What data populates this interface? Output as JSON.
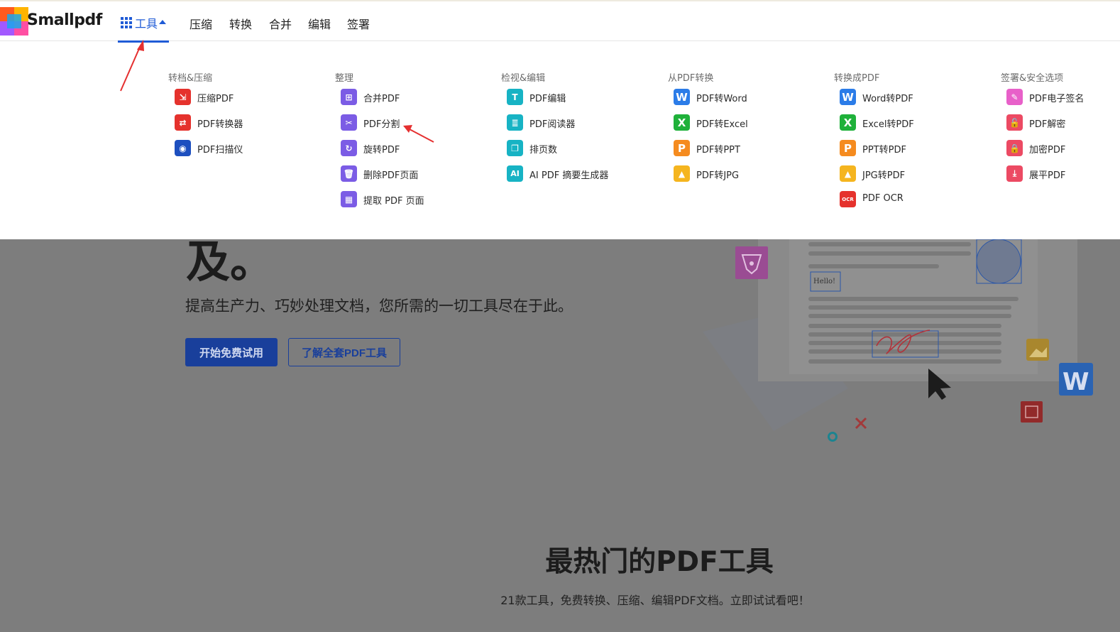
{
  "header": {
    "brand": "Smallpdf",
    "nav": {
      "tools": "工具",
      "items": [
        "压缩",
        "转换",
        "合并",
        "编辑",
        "签署"
      ]
    }
  },
  "menu": {
    "columns": [
      {
        "title": "转档&压缩",
        "items": [
          {
            "label": "压缩PDF",
            "icon": "compress-icon",
            "color": "#e5322d"
          },
          {
            "label": "PDF转换器",
            "icon": "convert-icon",
            "color": "#e5322d"
          },
          {
            "label": "PDF扫描仪",
            "icon": "camera-icon",
            "color": "#1d4fbf"
          }
        ]
      },
      {
        "title": "整理",
        "items": [
          {
            "label": "合并PDF",
            "icon": "merge-icon",
            "color": "#7b5ce5"
          },
          {
            "label": "PDF分割",
            "icon": "scissors-icon",
            "color": "#7b5ce5"
          },
          {
            "label": "旋转PDF",
            "icon": "rotate-icon",
            "color": "#7b5ce5"
          },
          {
            "label": "删除PDF页面",
            "icon": "trash-icon",
            "color": "#7b5ce5"
          },
          {
            "label": "提取 PDF 页面",
            "icon": "extract-icon",
            "color": "#7b5ce5"
          }
        ]
      },
      {
        "title": "检视&编辑",
        "items": [
          {
            "label": "PDF编辑",
            "icon": "text-edit-icon",
            "color": "#17b3c4"
          },
          {
            "label": "PDF阅读器",
            "icon": "reader-icon",
            "color": "#17b3c4"
          },
          {
            "label": "排页数",
            "icon": "page-number-icon",
            "color": "#17b3c4"
          },
          {
            "label": "AI PDF 摘要生成器",
            "icon": "ai-icon",
            "color": "#17b3c4"
          }
        ]
      },
      {
        "title": "从PDF转换",
        "items": [
          {
            "label": "PDF转Word",
            "icon": "word-icon",
            "color": "#2b7ce8"
          },
          {
            "label": "PDF转Excel",
            "icon": "excel-icon",
            "color": "#1fb13a"
          },
          {
            "label": "PDF转PPT",
            "icon": "ppt-icon",
            "color": "#f58b1f"
          },
          {
            "label": "PDF转JPG",
            "icon": "image-icon",
            "color": "#f5b51f"
          }
        ]
      },
      {
        "title": "转换成PDF",
        "items": [
          {
            "label": "Word转PDF",
            "icon": "word-icon",
            "color": "#2b7ce8"
          },
          {
            "label": "Excel转PDF",
            "icon": "excel-icon",
            "color": "#1fb13a"
          },
          {
            "label": "PPT转PDF",
            "icon": "ppt-icon",
            "color": "#f58b1f"
          },
          {
            "label": "JPG转PDF",
            "icon": "image-icon",
            "color": "#f5b51f"
          },
          {
            "label": "PDF OCR",
            "icon": "ocr-icon",
            "color": "#e5322d"
          }
        ]
      },
      {
        "title": "签署&安全选项",
        "items": [
          {
            "label": "PDF电子签名",
            "icon": "signature-icon",
            "color": "#e860c9"
          },
          {
            "label": "PDF解密",
            "icon": "unlock-icon",
            "color": "#ec4a63"
          },
          {
            "label": "加密PDF",
            "icon": "lock-icon",
            "color": "#ec4a63"
          },
          {
            "label": "展平PDF",
            "icon": "flatten-icon",
            "color": "#ec4a63"
          }
        ]
      }
    ]
  },
  "hero": {
    "heading_tail": "及。",
    "subtitle": "提高生产力、巧妙处理文档，您所需的一切工具尽在于此。",
    "primary_button": "开始免费试用",
    "secondary_button": "了解全套PDF工具",
    "illustration": {
      "hello_text": "Hello!"
    }
  },
  "popular": {
    "title": "最热门的PDF工具",
    "subtitle": "21款工具，免费转换、压缩、编辑PDF文档。立即试试看吧！"
  }
}
